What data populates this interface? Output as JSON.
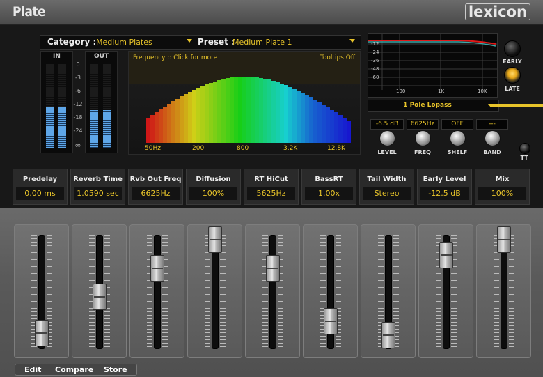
{
  "window": {
    "title": "Plate",
    "brand": "lexicon"
  },
  "category": {
    "label": "Category :",
    "value": "Medium Plates"
  },
  "preset": {
    "label": "Preset :",
    "value": "Medium Plate 1"
  },
  "meters": {
    "in_label": "IN",
    "out_label": "OUT",
    "scale": [
      "0",
      "-3",
      "-6",
      "-12",
      "-18",
      "-24",
      "∞"
    ]
  },
  "spectrum": {
    "header": "Frequency :: Click for more",
    "tooltips": "Tooltips Off",
    "freqs": [
      "50Hz",
      "200",
      "800",
      "3.2K",
      "12.8K"
    ]
  },
  "eq": {
    "db_labels": [
      "-12",
      "-24",
      "-36",
      "-48",
      "-60"
    ],
    "freq_labels": [
      "100",
      "1K",
      "10K"
    ],
    "filter": "1 Pole Lopass"
  },
  "eq_controls": [
    {
      "label": "LEVEL",
      "value": "-6.5 dB"
    },
    {
      "label": "FREQ",
      "value": "6625Hz"
    },
    {
      "label": "SHELF",
      "value": "OFF"
    },
    {
      "label": "BAND",
      "value": "---"
    }
  ],
  "early_label": "EARLY",
  "late_label": "LATE",
  "tt_label": "TT",
  "params": [
    {
      "name": "Predelay",
      "value": "0.00 ms",
      "level": 0.08
    },
    {
      "name": "Reverb Time",
      "value": "1.0590 sec",
      "level": 0.44
    },
    {
      "name": "Rvb Out Freq",
      "value": "6625Hz",
      "level": 0.72
    },
    {
      "name": "Diffusion",
      "value": "100%",
      "level": 1.0
    },
    {
      "name": "RT HiCut",
      "value": "5625Hz",
      "level": 0.72
    },
    {
      "name": "BassRT",
      "value": "1.00x",
      "level": 0.2
    },
    {
      "name": "Tail Width",
      "value": "Stereo",
      "level": 0.06
    },
    {
      "name": "Early Level",
      "value": "-12.5 dB",
      "level": 0.85
    },
    {
      "name": "Mix",
      "value": "100%",
      "level": 1.0
    }
  ],
  "footer": {
    "edit": "Edit",
    "compare": "Compare",
    "store": "Store"
  },
  "colors": {
    "accent": "#e8c42a",
    "early": "#222222",
    "late": "#e8a818"
  }
}
